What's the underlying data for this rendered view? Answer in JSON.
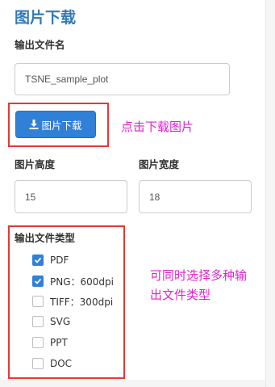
{
  "header": {
    "title": "图片下载"
  },
  "filename": {
    "label": "输出文件名",
    "value": "TSNE_sample_plot"
  },
  "download": {
    "label": "图片下载",
    "annotation": "点击下载图片"
  },
  "height_field": {
    "label": "图片高度",
    "value": "15"
  },
  "width_field": {
    "label": "图片宽度",
    "value": "18"
  },
  "filetype": {
    "label": "输出文件类型",
    "annotation_line1": "可同时选择多种输",
    "annotation_line2": "出文件类型",
    "options": [
      {
        "label": "PDF",
        "checked": true
      },
      {
        "label": "PNG：600dpi",
        "checked": true
      },
      {
        "label": "TIFF：300dpi",
        "checked": false
      },
      {
        "label": "SVG",
        "checked": false
      },
      {
        "label": "PPT",
        "checked": false
      },
      {
        "label": "DOC",
        "checked": false
      }
    ]
  },
  "colors": {
    "primary": "#2f80d6",
    "title": "#337ab7",
    "highlight": "#e53935",
    "annotation": "#e020d0"
  }
}
